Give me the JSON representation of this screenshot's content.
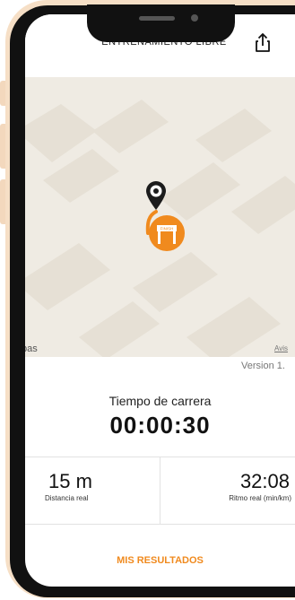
{
  "header": {
    "title": "ENTRENAMIENTO LIBRE",
    "share_icon": "share-icon"
  },
  "map": {
    "label_left": "pas",
    "label_right": "Avis",
    "marker_icon": "location-pin-icon",
    "finish_icon": "finish-gate-icon",
    "finish_text": "FINISH"
  },
  "version_text": "Version 1.",
  "run": {
    "time_label": "Tiempo de carrera",
    "time_value": "00:00:30",
    "distance_value": "15 m",
    "distance_label": "Distancia real",
    "pace_value": "32:08",
    "pace_label": "Ritmo real (min/km)"
  },
  "actions": {
    "results_label": "MIS RESULTADOS"
  },
  "colors": {
    "accent": "#f08a1e",
    "phone_frame": "#f6dfc6",
    "map_background": "#efebe3"
  }
}
